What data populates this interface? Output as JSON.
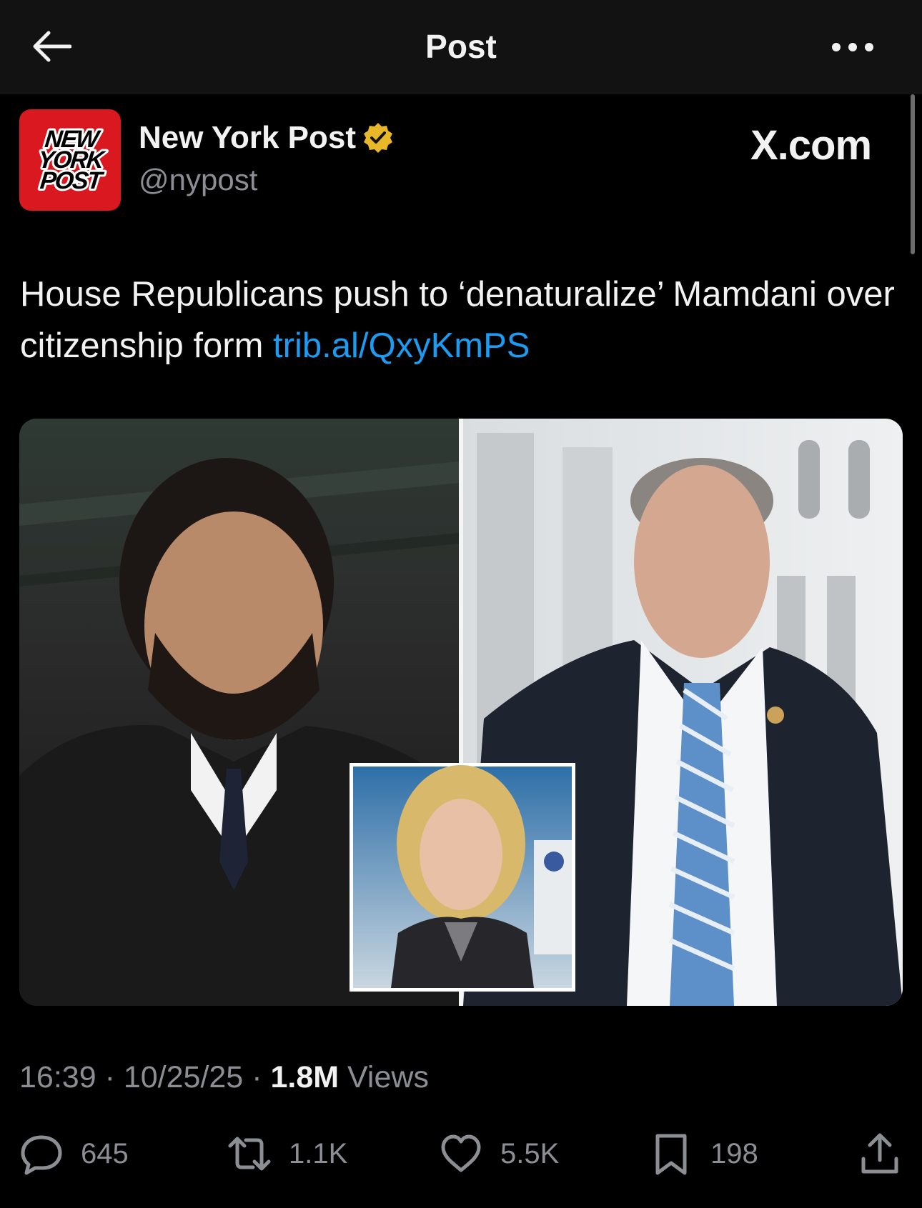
{
  "header": {
    "title": "Post",
    "back_icon": "arrow-left-icon",
    "more_icon": "more-horizontal-icon"
  },
  "account": {
    "name": "New York Post",
    "handle": "@nypost",
    "logo_lines": [
      "NEW",
      "YORK",
      "POST"
    ],
    "verified_color": "#e8b829",
    "logo_color": "#d9181f"
  },
  "branding": {
    "watermark": "X.com"
  },
  "post": {
    "text": "House Republicans push to ‘denaturalize’ Mamdani over citizenship form ",
    "link": "trib.al/QxyKmPS",
    "link_color": "#1d9bf0"
  },
  "meta": {
    "time": "16:39",
    "date": "10/25/25",
    "views_count": "1.8M",
    "views_label": " Views"
  },
  "actions": {
    "replies": "645",
    "reposts": "1.1K",
    "likes": "5.5K",
    "bookmarks": "198"
  }
}
